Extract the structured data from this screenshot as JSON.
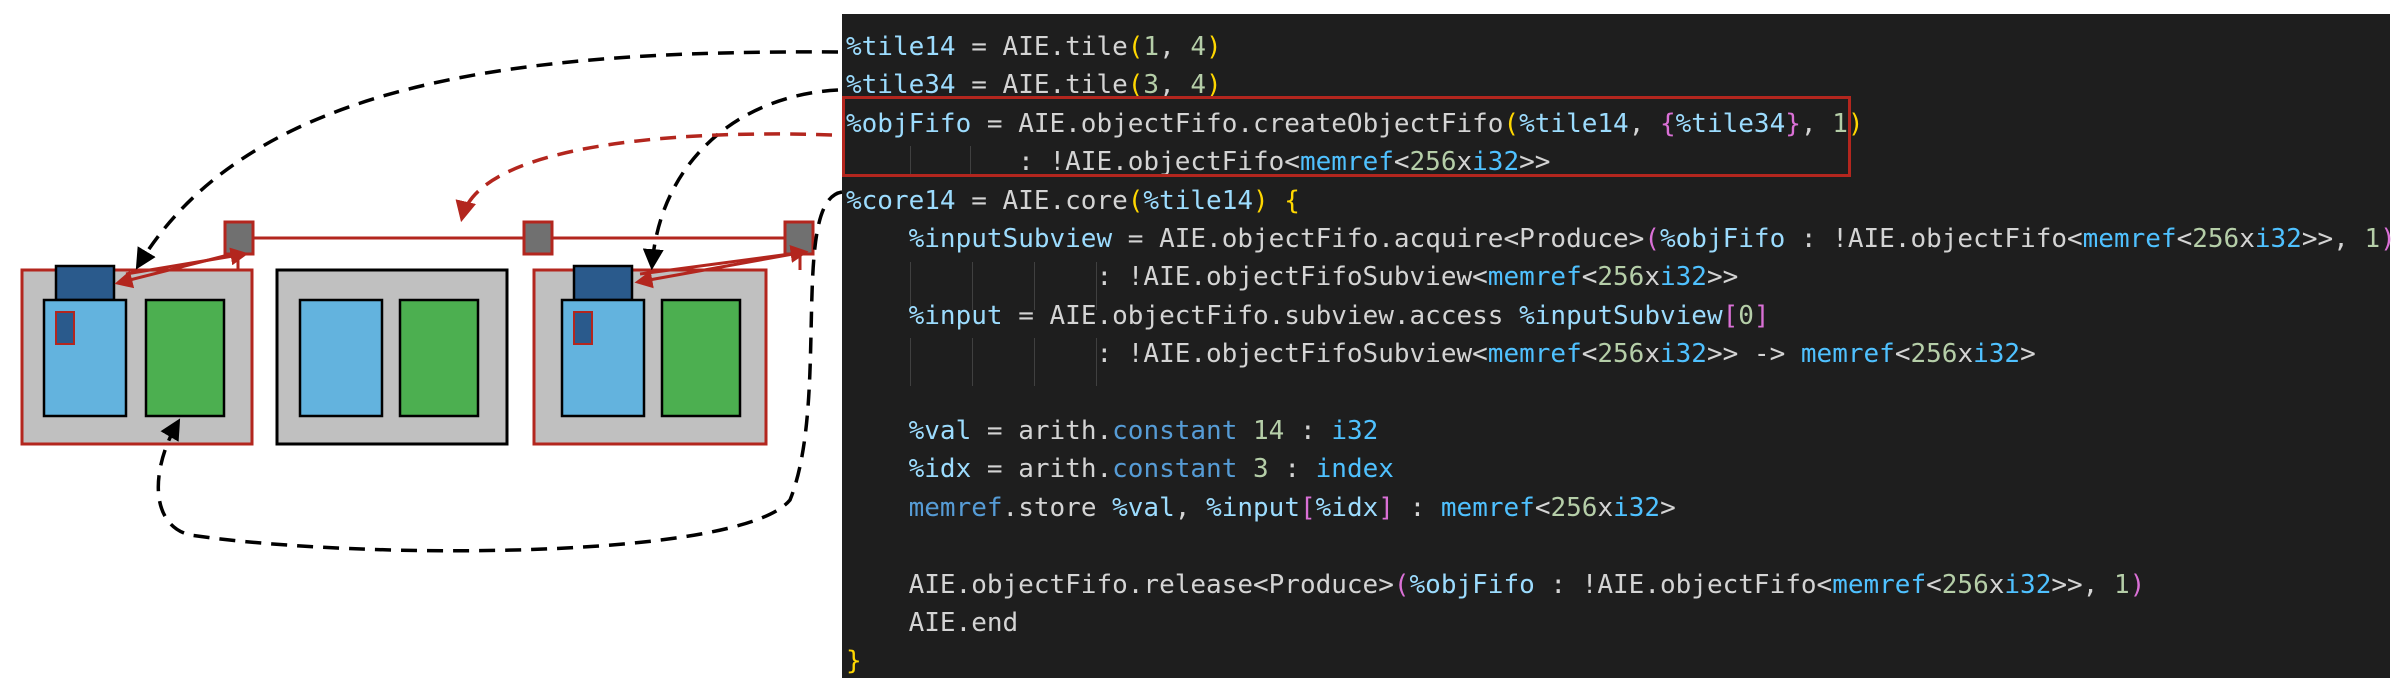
{
  "colors": {
    "code_bg": "#1e1e1e",
    "variable": "#9cdcfe",
    "plain": "#d4d4d4",
    "number": "#b5cea8",
    "type": "#4fc1ff",
    "keyword": "#569cd6",
    "bracket_level1": "#ffd700",
    "bracket_level2": "#da70d6",
    "bracket_level3": "#179fff",
    "highlight_box": "#b3261e",
    "tile_bg": "#c0c0c0",
    "core": "#63b3de",
    "memory": "#4caf50",
    "lock": "#2a5a8c",
    "port": "#707070"
  },
  "code": {
    "lines": [
      [
        [
          "%tile14",
          "var"
        ],
        [
          " = AIE.tile",
          "fn"
        ],
        [
          "(",
          "b1"
        ],
        [
          "1",
          "num"
        ],
        [
          ", ",
          "fn"
        ],
        [
          "4",
          "num"
        ],
        [
          ")",
          "b1"
        ]
      ],
      [
        [
          "%tile34",
          "var"
        ],
        [
          " = AIE.tile",
          "fn"
        ],
        [
          "(",
          "b1"
        ],
        [
          "3",
          "num"
        ],
        [
          ", ",
          "fn"
        ],
        [
          "4",
          "num"
        ],
        [
          ")",
          "b1"
        ]
      ],
      [
        [
          "%objFifo",
          "var"
        ],
        [
          " = AIE.objectFifo.createObjectFifo",
          "fn"
        ],
        [
          "(",
          "b1"
        ],
        [
          "%tile14",
          "var"
        ],
        [
          ", ",
          "fn"
        ],
        [
          "{",
          "b2"
        ],
        [
          "%tile34",
          "var"
        ],
        [
          "}",
          "b2"
        ],
        [
          ", ",
          "fn"
        ],
        [
          "1",
          "num"
        ],
        [
          ")",
          "b1"
        ]
      ],
      [
        [
          "           : !AIE.objectFifo<",
          "fn"
        ],
        [
          "memref",
          "type"
        ],
        [
          "<",
          "fn"
        ],
        [
          "256",
          "num"
        ],
        [
          "x",
          "fn"
        ],
        [
          "i32",
          "type"
        ],
        [
          ">>",
          "fn"
        ]
      ],
      [
        [
          "%core14",
          "var"
        ],
        [
          " = AIE.core",
          "fn"
        ],
        [
          "(",
          "b1"
        ],
        [
          "%tile14",
          "var"
        ],
        [
          ")",
          "b1"
        ],
        [
          " {",
          "b1"
        ]
      ],
      [
        [
          "    ",
          "fn"
        ],
        [
          "%inputSubview",
          "var"
        ],
        [
          " = AIE.objectFifo.acquire<Produce>",
          "fn"
        ],
        [
          "(",
          "b2"
        ],
        [
          "%objFifo",
          "var"
        ],
        [
          " : !AIE.objectFifo<",
          "fn"
        ],
        [
          "memref",
          "type"
        ],
        [
          "<",
          "fn"
        ],
        [
          "256",
          "num"
        ],
        [
          "x",
          "fn"
        ],
        [
          "i32",
          "type"
        ],
        [
          ">>, ",
          "fn"
        ],
        [
          "1",
          "num"
        ],
        [
          ")",
          "b2"
        ]
      ],
      [
        [
          "                : !AIE.objectFifoSubview<",
          "fn"
        ],
        [
          "memref",
          "type"
        ],
        [
          "<",
          "fn"
        ],
        [
          "256",
          "num"
        ],
        [
          "x",
          "fn"
        ],
        [
          "i32",
          "type"
        ],
        [
          ">>",
          "fn"
        ]
      ],
      [
        [
          "    ",
          "fn"
        ],
        [
          "%input",
          "var"
        ],
        [
          " = AIE.objectFifo.subview.access ",
          "fn"
        ],
        [
          "%inputSubview",
          "var"
        ],
        [
          "[",
          "b2"
        ],
        [
          "0",
          "num"
        ],
        [
          "]",
          "b2"
        ]
      ],
      [
        [
          "                : !AIE.objectFifoSubview<",
          "fn"
        ],
        [
          "memref",
          "type"
        ],
        [
          "<",
          "fn"
        ],
        [
          "256",
          "num"
        ],
        [
          "x",
          "fn"
        ],
        [
          "i32",
          "type"
        ],
        [
          ">> -> ",
          "fn"
        ],
        [
          "memref",
          "type"
        ],
        [
          "<",
          "fn"
        ],
        [
          "256",
          "num"
        ],
        [
          "x",
          "fn"
        ],
        [
          "i32",
          "type"
        ],
        [
          ">",
          "fn"
        ]
      ],
      [],
      [
        [
          "    ",
          "fn"
        ],
        [
          "%val",
          "var"
        ],
        [
          " = arith.",
          "fn"
        ],
        [
          "constant",
          "kw"
        ],
        [
          " ",
          "fn"
        ],
        [
          "14",
          "num"
        ],
        [
          " : ",
          "fn"
        ],
        [
          "i32",
          "type"
        ]
      ],
      [
        [
          "    ",
          "fn"
        ],
        [
          "%idx",
          "var"
        ],
        [
          " = arith.",
          "fn"
        ],
        [
          "constant",
          "kw"
        ],
        [
          " ",
          "fn"
        ],
        [
          "3",
          "num"
        ],
        [
          " : ",
          "fn"
        ],
        [
          "index",
          "type"
        ]
      ],
      [
        [
          "    ",
          "fn"
        ],
        [
          "memref",
          "kw"
        ],
        [
          ".store ",
          "fn"
        ],
        [
          "%val",
          "var"
        ],
        [
          ", ",
          "fn"
        ],
        [
          "%input",
          "var"
        ],
        [
          "[",
          "b2"
        ],
        [
          "%idx",
          "var"
        ],
        [
          "]",
          "b2"
        ],
        [
          " : ",
          "fn"
        ],
        [
          "memref",
          "type"
        ],
        [
          "<",
          "fn"
        ],
        [
          "256",
          "num"
        ],
        [
          "x",
          "fn"
        ],
        [
          "i32",
          "type"
        ],
        [
          ">",
          "fn"
        ]
      ],
      [],
      [
        [
          "    AIE.objectFifo.release<Produce>",
          "fn"
        ],
        [
          "(",
          "b2"
        ],
        [
          "%objFifo",
          "var"
        ],
        [
          " : !AIE.objectFifo<",
          "fn"
        ],
        [
          "memref",
          "type"
        ],
        [
          "<",
          "fn"
        ],
        [
          "256",
          "num"
        ],
        [
          "x",
          "fn"
        ],
        [
          "i32",
          "type"
        ],
        [
          ">>, ",
          "fn"
        ],
        [
          "1",
          "num"
        ],
        [
          ")",
          "b2"
        ]
      ],
      [
        [
          "    AIE.end",
          "fn"
        ]
      ],
      [
        [
          "}",
          "b1"
        ]
      ]
    ]
  }
}
